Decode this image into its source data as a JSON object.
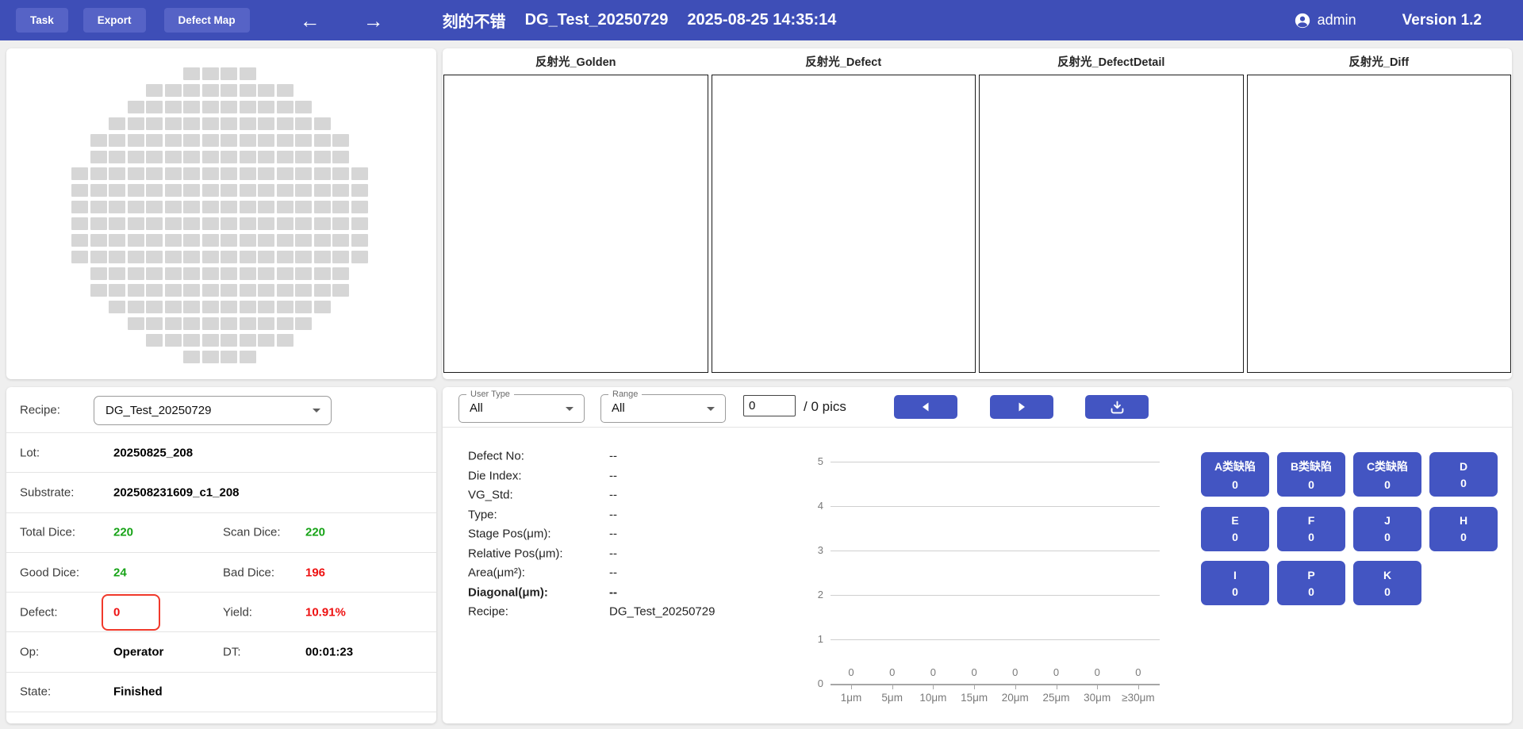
{
  "topbar": {
    "buttons": [
      {
        "label": "Task"
      },
      {
        "label": "Export"
      },
      {
        "label": "Defect Map"
      }
    ],
    "icons": [
      "arrow-left",
      "arrow-right",
      "account-person"
    ],
    "title": {
      "name": "刻的不错",
      "dataset": "DG_Test_20250729",
      "datetime": "2025-08-25 14:35:14"
    },
    "user": "admin",
    "version": "Version 1.2"
  },
  "wafer_map": {
    "total_dice": 220,
    "row_counts": [
      4,
      8,
      10,
      12,
      14,
      14,
      16,
      16,
      16,
      16,
      16,
      16,
      14,
      14,
      12,
      10,
      8,
      4
    ],
    "die_color": "#d6d6d6"
  },
  "image_panels": [
    {
      "label": "反射光_Golden"
    },
    {
      "label": "反射光_Defect"
    },
    {
      "label": "反射光_DefectDetail"
    },
    {
      "label": "反射光_Diff"
    }
  ],
  "recipe": {
    "label": "Recipe:",
    "value": "DG_Test_20250729"
  },
  "stats_rows": [
    {
      "label": "Lot:",
      "value": "20250825_208"
    },
    {
      "label": "Substrate:",
      "value": "202508231609_c1_208"
    },
    {
      "label": "Total Dice:",
      "value": "220",
      "color": "green",
      "label2": "Scan Dice:",
      "value2": "220",
      "color2": "green"
    },
    {
      "label": "Good Dice:",
      "value": "24",
      "color": "green",
      "label2": "Bad Dice:",
      "value2": "196",
      "color2": "red"
    },
    {
      "label": "Defect:",
      "value": "0",
      "color": "red",
      "boxed": true,
      "label2": "Yield:",
      "value2": "10.91%",
      "color2": "red"
    },
    {
      "label": "Op:",
      "value": "Operator",
      "label2": "DT:",
      "value2": "00:01:23"
    },
    {
      "label": "State:",
      "value": "Finished"
    }
  ],
  "filters": {
    "user_type": {
      "label": "User Type",
      "value": "All"
    },
    "range": {
      "label": "Range",
      "value": "All"
    },
    "page_input": "0",
    "page_total": "/ 0 pics"
  },
  "pager_icons": [
    "previous-triangle",
    "next-triangle",
    "download-tray"
  ],
  "defect_info": [
    {
      "label": "Defect No:",
      "value": "--"
    },
    {
      "label": "Die Index:",
      "value": "--"
    },
    {
      "label": "VG_Std:",
      "value": "--"
    },
    {
      "label": "Type:",
      "value": "--"
    },
    {
      "label": "Stage Pos(μm):",
      "value": "--"
    },
    {
      "label": "Relative Pos(μm):",
      "value": "--"
    },
    {
      "label": "Area(μm²):",
      "value": "--"
    },
    {
      "label": "Diagonal(μm):",
      "value": "--",
      "bold": true
    },
    {
      "label": "Recipe:",
      "value": "DG_Test_20250729"
    }
  ],
  "chart_data": {
    "type": "bar",
    "categories": [
      "1μm",
      "5μm",
      "10μm",
      "15μm",
      "20μm",
      "25μm",
      "30μm",
      "≥30μm"
    ],
    "values": [
      0,
      0,
      0,
      0,
      0,
      0,
      0,
      0
    ],
    "yticks": [
      0,
      1,
      2,
      3,
      4,
      5
    ],
    "ylim": [
      0,
      5
    ],
    "grid": true,
    "legend_position": "none",
    "title": "",
    "xlabel": "",
    "ylabel": ""
  },
  "defect_classes": [
    {
      "label": "A类缺陷",
      "count": "0"
    },
    {
      "label": "B类缺陷",
      "count": "0"
    },
    {
      "label": "C类缺陷",
      "count": "0"
    },
    {
      "label": "D",
      "count": "0"
    },
    {
      "label": "E",
      "count": "0"
    },
    {
      "label": "F",
      "count": "0"
    },
    {
      "label": "J",
      "count": "0"
    },
    {
      "label": "H",
      "count": "0"
    },
    {
      "label": "I",
      "count": "0"
    },
    {
      "label": "P",
      "count": "0"
    },
    {
      "label": "K",
      "count": "0"
    }
  ],
  "colors": {
    "topbar": "#3e4eb7",
    "accent": "#4355c2",
    "green": "#17a317",
    "red": "#ee1111",
    "die": "#d6d6d6"
  }
}
